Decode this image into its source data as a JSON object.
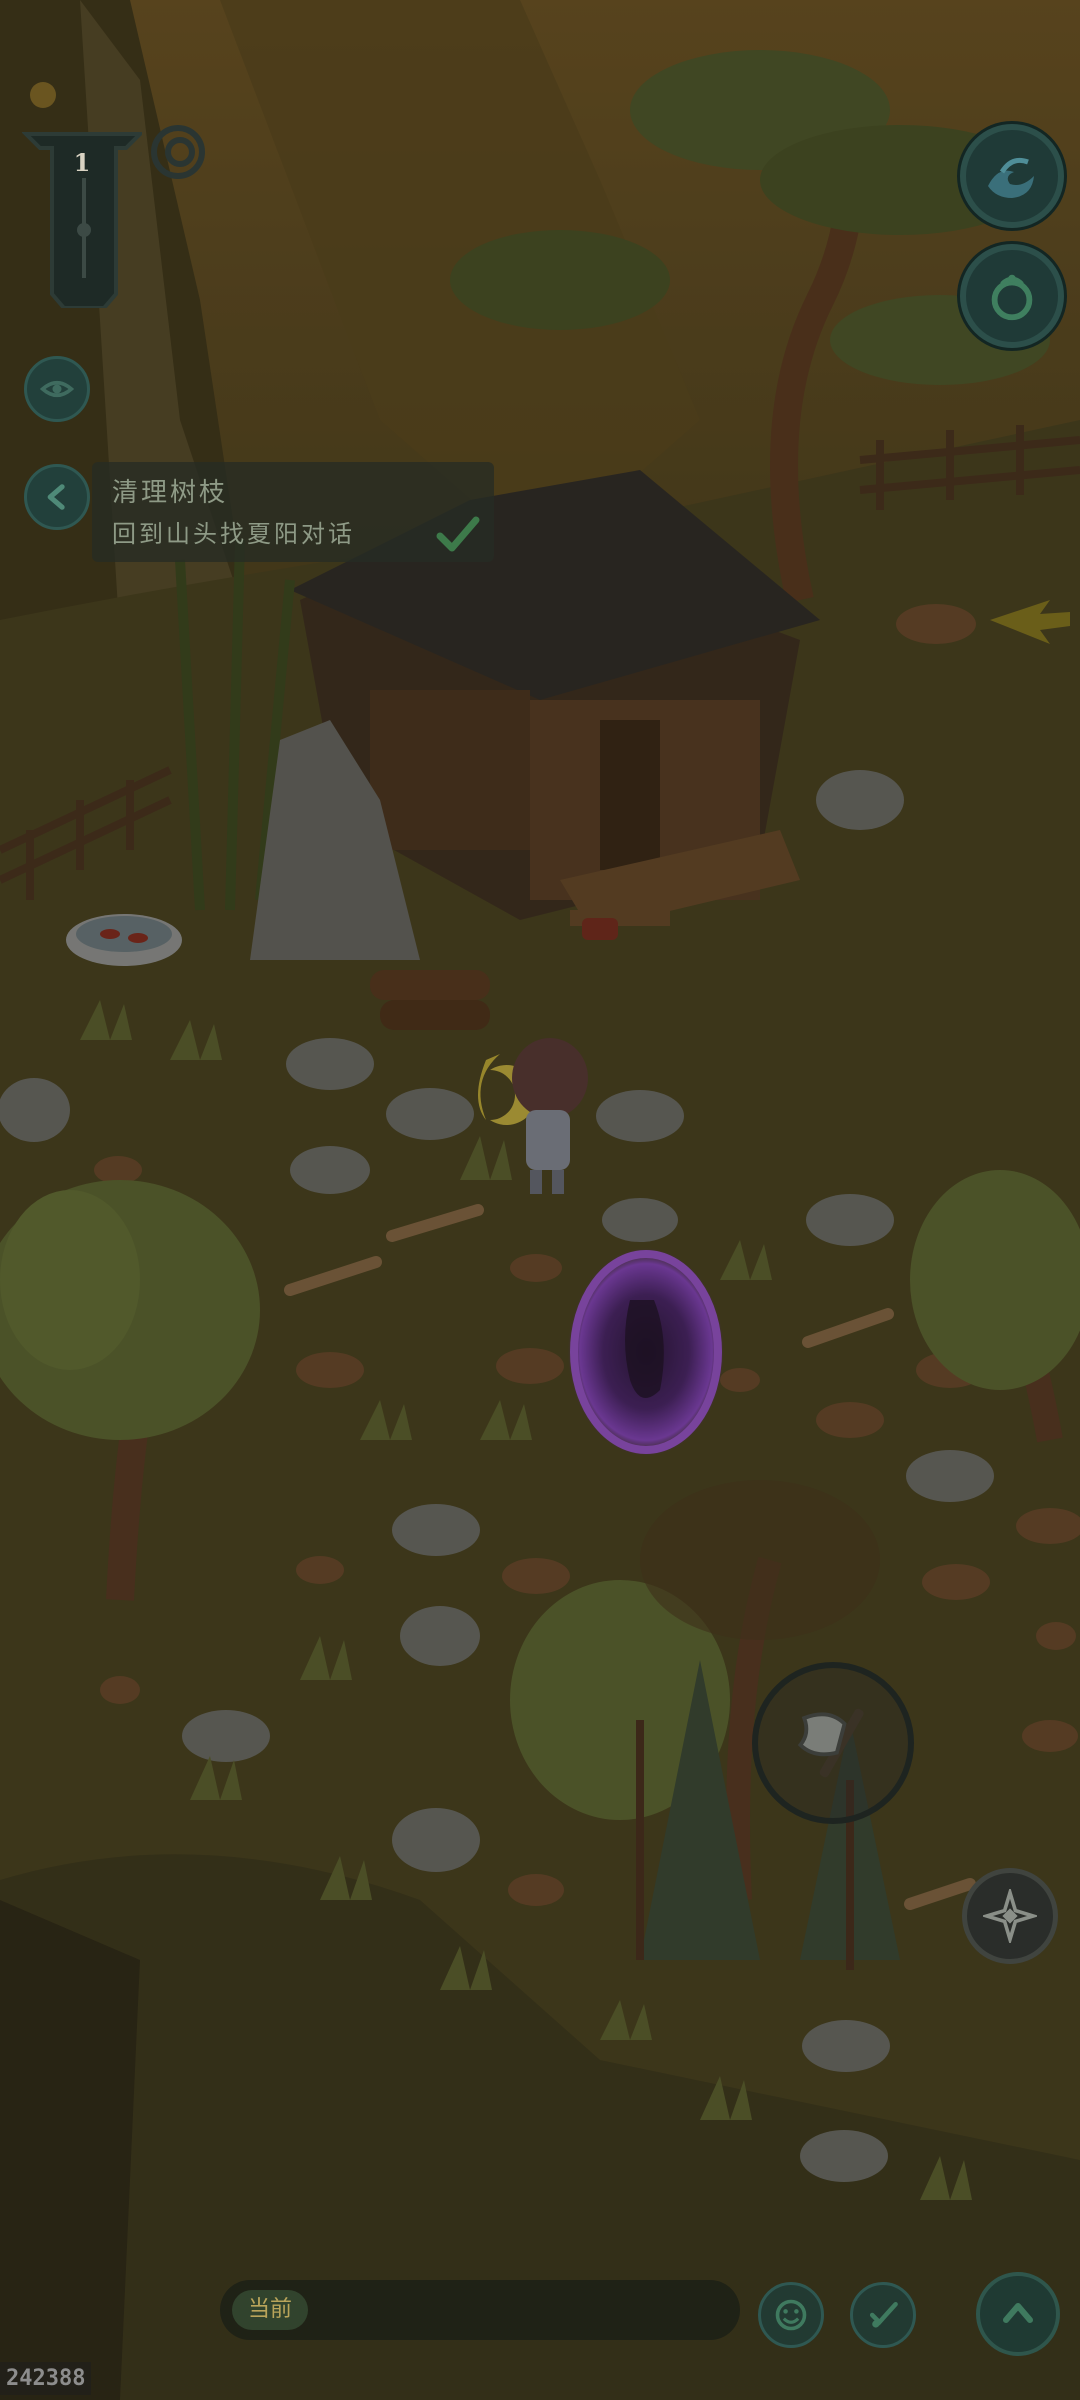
{
  "hud": {
    "level": "1",
    "quest": {
      "title": "清理树枝",
      "description": "回到山头找夏阳对话"
    },
    "chat": {
      "channel_label": "当前"
    },
    "build_id": "242388"
  },
  "icons": {
    "top_right": [
      "wave-icon",
      "bag-icon"
    ],
    "left": [
      "eye-icon",
      "back-arrow-icon"
    ],
    "action": "axe-icon",
    "skill": "compass-star-icon",
    "chat_buttons": [
      "emoji-icon",
      "brush-icon",
      "chevron-up-icon"
    ]
  },
  "colors": {
    "overlay": "#2a2514",
    "button_teal": "#1f3a37",
    "portal_purple": "#7c3aa8",
    "grass_dark": "#4b4522"
  }
}
